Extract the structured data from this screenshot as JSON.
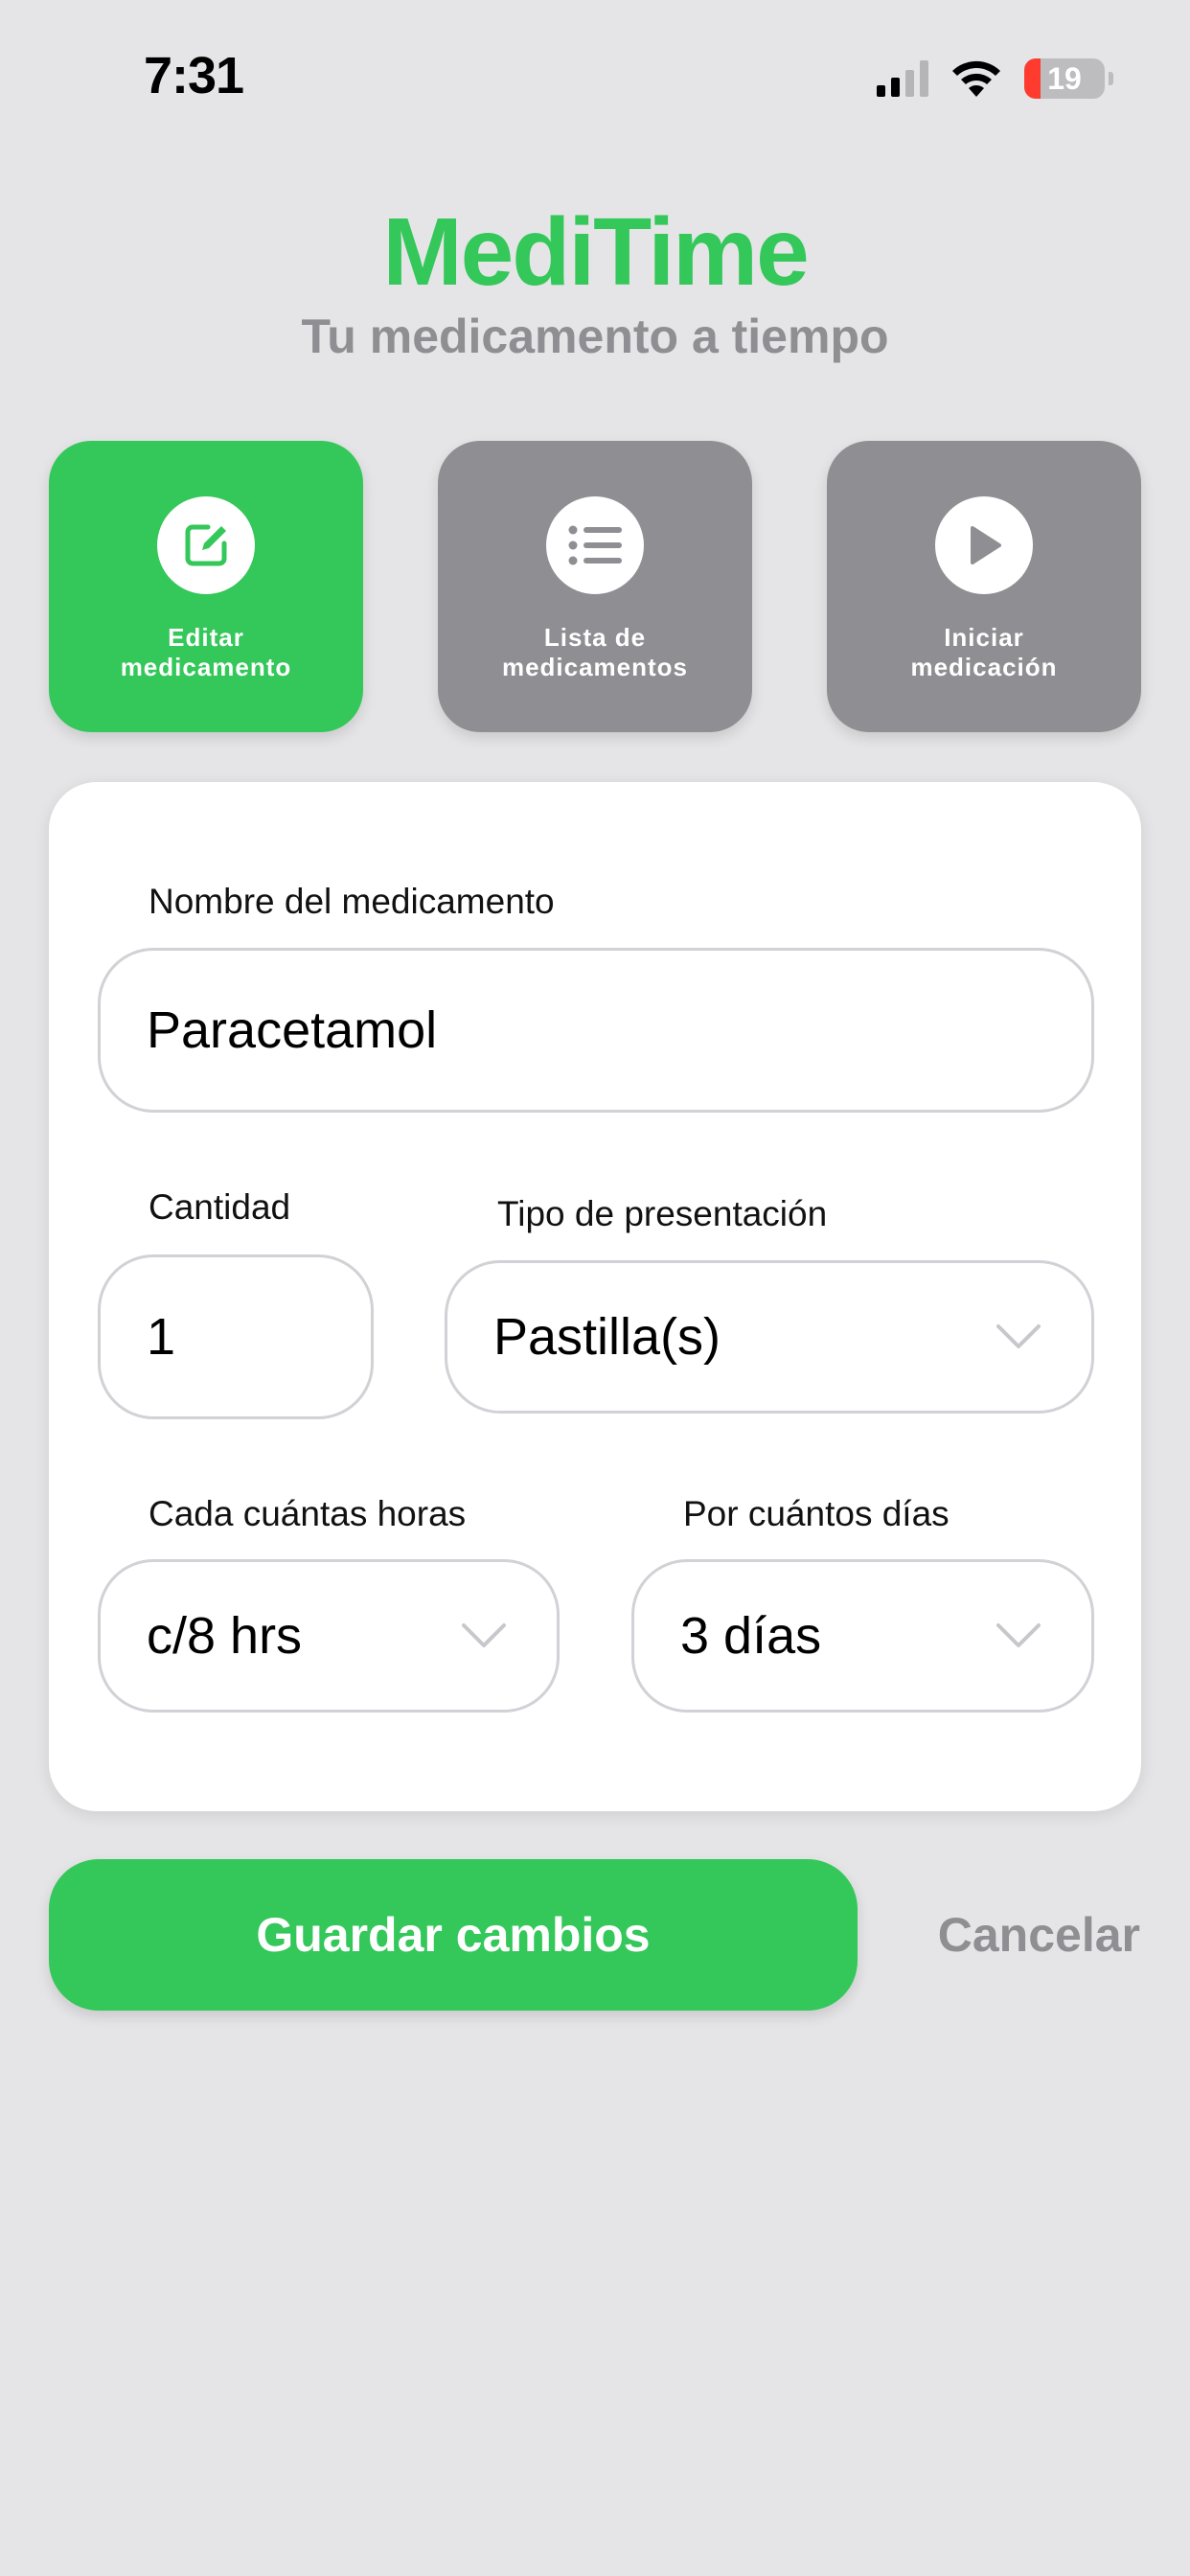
{
  "status_bar": {
    "time": "7:31",
    "battery_level": "19"
  },
  "header": {
    "title": "MediTime",
    "subtitle": "Tu medicamento a tiempo"
  },
  "tiles": [
    {
      "label_line1": "Editar",
      "label_line2": "medicamento",
      "icon": "edit-icon",
      "active": true
    },
    {
      "label_line1": "Lista de",
      "label_line2": "medicamentos",
      "icon": "list-icon",
      "active": false
    },
    {
      "label_line1": "Iniciar",
      "label_line2": "medicación",
      "icon": "play-icon",
      "active": false
    }
  ],
  "form": {
    "name_label": "Nombre del medicamento",
    "name_value": "Paracetamol",
    "quantity_label": "Cantidad",
    "quantity_value": "1",
    "presentation_label": "Tipo de presentación",
    "presentation_value": "Pastilla(s)",
    "interval_label": "Cada cuántas horas",
    "interval_value": "c/8 hrs",
    "duration_label": "Por cuántos días",
    "duration_value": "3 días"
  },
  "actions": {
    "save_label": "Guardar cambios",
    "cancel_label": "Cancelar"
  },
  "colors": {
    "accent": "#34c759",
    "inactive_tile": "#8e8e93",
    "background": "#e5e5e7"
  }
}
